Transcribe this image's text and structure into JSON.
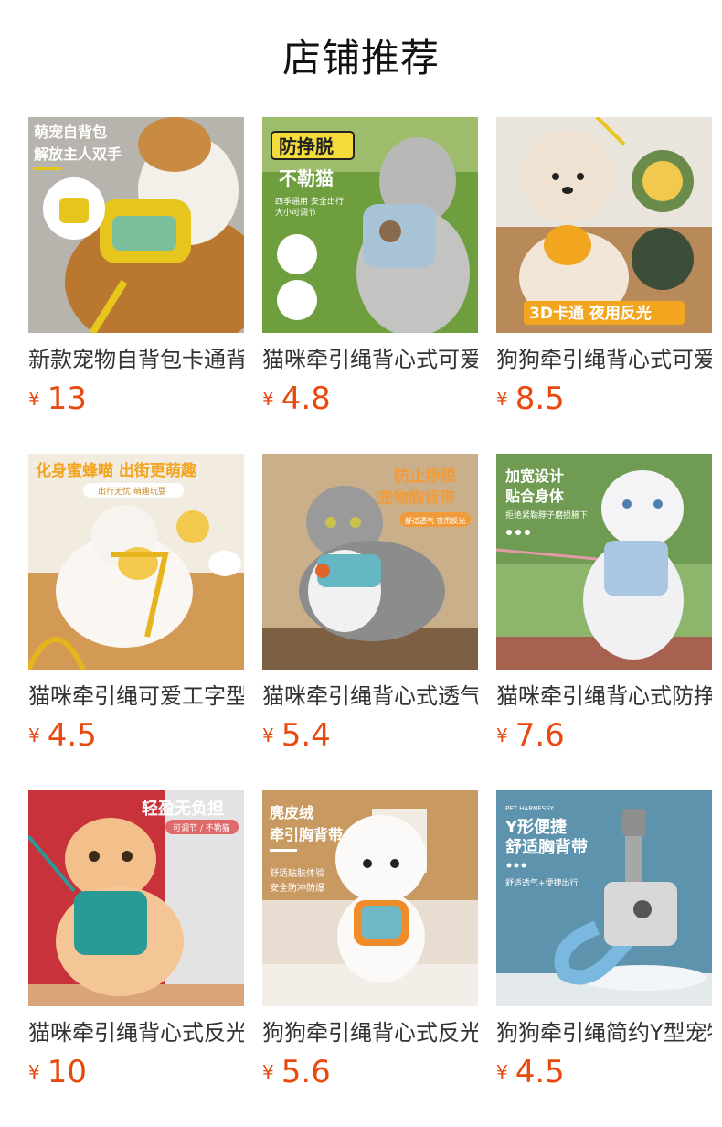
{
  "header": {
    "title": "店铺推荐"
  },
  "products": [
    {
      "name": "新款宠物自背包卡通背心式牵引绳",
      "currency": "¥",
      "price": "13",
      "image_text": [
        "萌宠自背包",
        "解放主人双手"
      ]
    },
    {
      "name": "猫咪牵引绳背心式可爱防挣脱",
      "currency": "¥",
      "price": "4.8",
      "image_text": [
        "防挣脱",
        "不勒猫",
        "四季通用 安全出行",
        "大小可调节"
      ]
    },
    {
      "name": "狗狗牵引绳背心式可爱卡通",
      "currency": "¥",
      "price": "8.5",
      "image_text": [
        "3D卡通 夜用反光"
      ]
    },
    {
      "name": "猫咪牵引绳可爱工字型蜜蜂",
      "currency": "¥",
      "price": "4.5",
      "image_text": [
        "化身蜜蜂喵 出街更萌趣",
        "出行无忧 萌趣玩耍"
      ]
    },
    {
      "name": "猫咪牵引绳背心式透气胸背带",
      "currency": "¥",
      "price": "5.4",
      "image_text": [
        "防止挣脱",
        "宠物胸背带",
        "舒适透气 夜用反光"
      ]
    },
    {
      "name": "猫咪牵引绳背心式防挣脱加宽",
      "currency": "¥",
      "price": "7.6",
      "image_text": [
        "加宽设计",
        "贴合身体",
        "拒绝紧勒脖子磨损腋下"
      ]
    },
    {
      "name": "猫咪牵引绳背心式反光轻盈",
      "currency": "¥",
      "price": "10",
      "image_text": [
        "轻盈无负担",
        "可调节 / 不勒猫"
      ]
    },
    {
      "name": "狗狗牵引绳背心式反光麂皮绒",
      "currency": "¥",
      "price": "5.6",
      "image_text": [
        "麂皮绒",
        "牵引胸背带",
        "舒适贴肤体验",
        "安全防冲防爆"
      ]
    },
    {
      "name": "狗狗牵引绳简约Y型宠物胸背带",
      "currency": "¥",
      "price": "4.5",
      "image_text": [
        "PET HARNESSY",
        "Y形便捷",
        "舒适胸背带",
        "舒适透气+便捷出行"
      ]
    }
  ],
  "colors": {
    "price": "#e8490f",
    "title": "#111111",
    "name": "#333333"
  }
}
